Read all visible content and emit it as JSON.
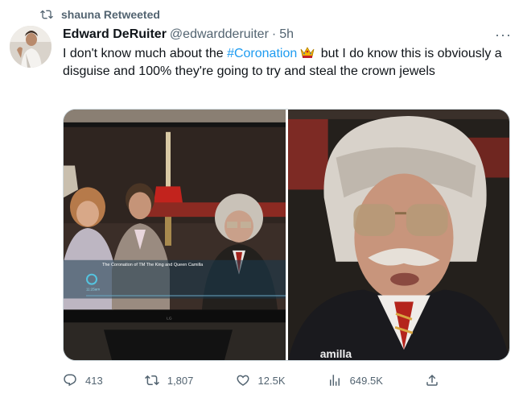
{
  "retweet": {
    "icon": "retweet-icon",
    "label": "shauna Retweeted"
  },
  "tweet": {
    "author": {
      "name": "Edward DeRuiter",
      "handle": "@edwardderuiter",
      "separator": "·",
      "time": "5h"
    },
    "more_label": "···",
    "text": {
      "part1": "I don't know much about the ",
      "hashtag": "#Coronation",
      "emoji_icon": "crown-emoji-icon",
      "part2": " but I do know this is obviously a disguise and 100% they're going to try and steal the crown jewels"
    },
    "media": {
      "left_caption": "The Coronation of TM The King and Queen Camilla",
      "left_time": "11:25am",
      "left_brand": "LG",
      "right_caption_fragment": "amilla"
    },
    "actions": {
      "replies": "413",
      "retweets": "1,807",
      "likes": "12.5K",
      "views": "649.5K"
    }
  },
  "colors": {
    "accent": "#1d9bf0",
    "muted": "#536471",
    "text": "#0f1419"
  }
}
